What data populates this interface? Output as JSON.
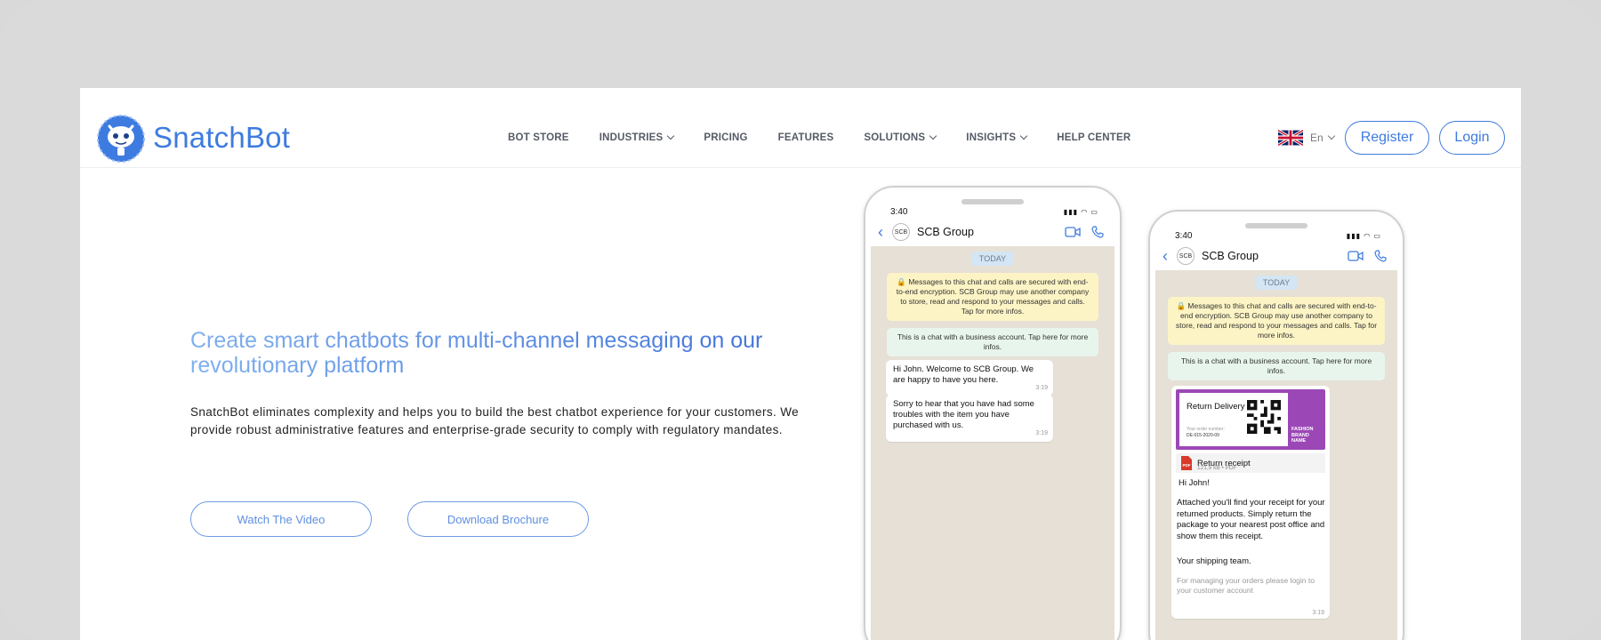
{
  "header": {
    "brand": "SnatchBot",
    "nav": [
      {
        "label": "BOT STORE",
        "dropdown": false
      },
      {
        "label": "INDUSTRIES",
        "dropdown": true
      },
      {
        "label": "PRICING",
        "dropdown": false
      },
      {
        "label": "FEATURES",
        "dropdown": false
      },
      {
        "label": "SOLUTIONS",
        "dropdown": true
      },
      {
        "label": "INSIGHTS",
        "dropdown": true
      },
      {
        "label": "HELP CENTER",
        "dropdown": false
      }
    ],
    "language": "En",
    "register_label": "Register",
    "login_label": "Login"
  },
  "hero": {
    "title": "Create smart chatbots for multi-channel messaging on our revolutionary platform",
    "description": "SnatchBot eliminates complexity and helps you to build the best chatbot experience for your customers. We provide robust administrative features and enterprise-grade security to comply with regulatory mandates.",
    "watch_video_label": "Watch The Video",
    "brochure_label": "Download Brochure"
  },
  "phone1": {
    "time": "3:40",
    "avatar": "SCB",
    "contact": "SCB Group",
    "today": "TODAY",
    "encryption": "🔒 Messages to this chat and calls are secured with end-to-end encryption. SCB Group may use another company to store, read and respond to your messages and calls. Tap for more infos.",
    "business": "This is a chat with a business account. Tap here for more infos.",
    "msg1": "Hi John. Welcome to SCB Group. We are happy to have you here.",
    "msg1_time": "3:19",
    "msg2": "Sorry to hear that you have had some troubles with the item you have purchased with us.",
    "msg2_time": "3:19"
  },
  "phone2": {
    "time": "3:40",
    "avatar": "SCB",
    "contact": "SCB Group",
    "today": "TODAY",
    "encryption": "🔒 Messages to this chat and calls are secured with end-to-end encryption. SCB Group may use another company to store, read and respond to your messages and calls. Tap for more infos.",
    "business": "This is a chat with a business account. Tap here for more infos.",
    "ticket_title": "Return Delivery",
    "ticket_sub": "Your order number:",
    "ticket_number": "DE-015-2020-09",
    "ticket_brand": "FASHION BRAND NAME",
    "file_name": "Return receipt",
    "file_meta": "121,9 kB • PDF",
    "greeting": "Hi John!",
    "body": "Attached you'll find your receipt for your returned products. Simply return the package to your nearest post office and show them this receipt.",
    "signoff": "Your shipping team.",
    "footer": "For managing your orders please login to your customer account",
    "msg_time": "3:19"
  }
}
